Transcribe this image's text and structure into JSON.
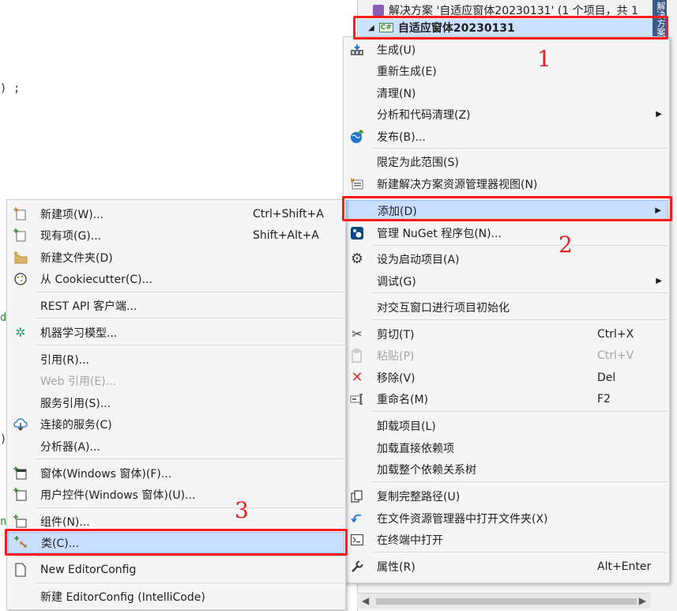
{
  "solution_explorer": {
    "solution_label": "解决方案 '自适应窗体20230131' (1 个项目，共 1",
    "project_label": "自适应窗体20230131",
    "side_tab": "解决方案"
  },
  "editor": {
    "fragments": [
      ") ;",
      "d",
      ")",
      "n"
    ]
  },
  "context_menu": {
    "items": [
      {
        "label": "生成(U)",
        "icon": "build-icon"
      },
      {
        "label": "重新生成(E)"
      },
      {
        "label": "清理(N)"
      },
      {
        "label": "分析和代码清理(Z)",
        "submenu": true
      },
      {
        "label": "发布(B)...",
        "icon": "publish-globe-icon"
      },
      {
        "label": "限定为此范围(S)"
      },
      {
        "label": "新建解决方案资源管理器视图(N)",
        "icon": "new-view-icon"
      },
      {
        "label": "添加(D)",
        "submenu": true,
        "highlighted": true
      },
      {
        "label": "管理 NuGet 程序包(N)...",
        "icon": "nuget-icon"
      },
      {
        "label": "设为启动项目(A)",
        "icon": "gear-icon"
      },
      {
        "label": "调试(G)",
        "submenu": true
      },
      {
        "label": "对交互窗口进行项目初始化"
      },
      {
        "label": "剪切(T)",
        "shortcut": "Ctrl+X",
        "icon": "scissors-icon"
      },
      {
        "label": "粘贴(P)",
        "shortcut": "Ctrl+V",
        "icon": "paste-icon",
        "disabled": true
      },
      {
        "label": "移除(V)",
        "shortcut": "Del",
        "icon": "delete-x-icon"
      },
      {
        "label": "重命名(M)",
        "shortcut": "F2",
        "icon": "rename-icon"
      },
      {
        "label": "卸载项目(L)"
      },
      {
        "label": "加载直接依赖项"
      },
      {
        "label": "加载整个依赖关系树"
      },
      {
        "label": "复制完整路径(U)",
        "icon": "copy-icon"
      },
      {
        "label": "在文件资源管理器中打开文件夹(X)",
        "icon": "open-folder-arrow-icon"
      },
      {
        "label": "在终端中打开",
        "icon": "terminal-icon"
      },
      {
        "label": "属性(R)",
        "shortcut": "Alt+Enter",
        "icon": "wrench-icon"
      }
    ]
  },
  "add_submenu": {
    "items": [
      {
        "label": "新建项(W)...",
        "shortcut": "Ctrl+Shift+A",
        "icon": "new-item-icon"
      },
      {
        "label": "现有项(G)...",
        "shortcut": "Shift+Alt+A",
        "icon": "existing-item-icon"
      },
      {
        "label": "新建文件夹(D)",
        "icon": "new-folder-icon"
      },
      {
        "label": "从 Cookiecutter(C)...",
        "icon": "cookiecutter-icon"
      },
      {
        "label": "REST API 客户端..."
      },
      {
        "label": "机器学习模型...",
        "icon": "ml-model-icon"
      },
      {
        "label": "引用(R)..."
      },
      {
        "label": "Web 引用(E)...",
        "disabled": true
      },
      {
        "label": "服务引用(S)..."
      },
      {
        "label": "连接的服务(C)",
        "icon": "connected-service-icon"
      },
      {
        "label": "分析器(A)..."
      },
      {
        "label": "窗体(Windows 窗体)(F)...",
        "icon": "form-icon"
      },
      {
        "label": "用户控件(Windows 窗体)(U)...",
        "icon": "user-control-icon"
      },
      {
        "label": "组件(N)...",
        "icon": "component-icon"
      },
      {
        "label": "类(C)...",
        "icon": "class-icon",
        "highlighted": true
      },
      {
        "label": "New EditorConfig",
        "icon": "file-icon"
      },
      {
        "label": "新建 EditorConfig (IntelliCode)"
      }
    ]
  },
  "annotations": {
    "step1": "1",
    "step2": "2",
    "step3": "3"
  },
  "colors": {
    "highlight_bg": "#c9deff",
    "annotation_red": "#ff1a1a"
  }
}
